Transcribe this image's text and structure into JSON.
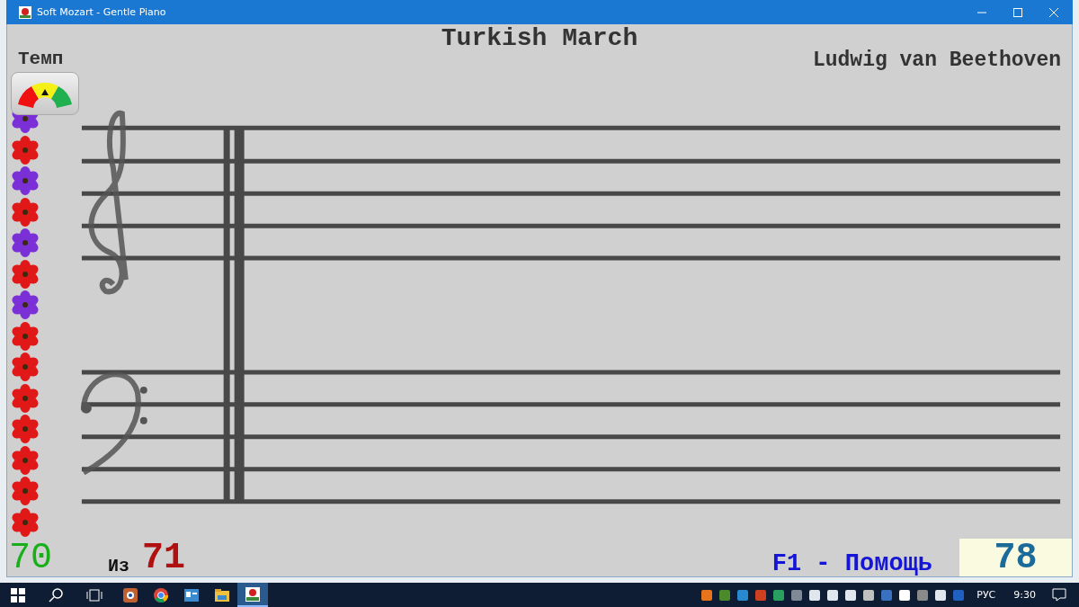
{
  "window": {
    "title": "Soft Mozart - Gentle Piano"
  },
  "score": {
    "tempo_label": "Темп",
    "title": "Turkish March",
    "composer": "Ludwig van Beethoven"
  },
  "flowers": [
    {
      "color": "#7b2fd6"
    },
    {
      "color": "#e01818"
    },
    {
      "color": "#7b2fd6"
    },
    {
      "color": "#e01818"
    },
    {
      "color": "#7b2fd6"
    },
    {
      "color": "#e01818"
    },
    {
      "color": "#7b2fd6"
    },
    {
      "color": "#e01818"
    },
    {
      "color": "#e01818"
    },
    {
      "color": "#e01818"
    },
    {
      "color": "#e01818"
    },
    {
      "color": "#e01818"
    },
    {
      "color": "#e01818"
    },
    {
      "color": "#e01818"
    }
  ],
  "footer": {
    "done": "70",
    "of_label": "Из",
    "total": "71",
    "help": "F1 - Помощь",
    "score": "78"
  },
  "taskbar": {
    "apps": [
      {
        "kind": "viewer",
        "selected": false
      },
      {
        "kind": "browser",
        "selected": false
      },
      {
        "kind": "contacts",
        "selected": false
      },
      {
        "kind": "folder",
        "selected": false
      },
      {
        "kind": "piano",
        "selected": true
      }
    ],
    "language": "РУС",
    "time": "9:30"
  }
}
